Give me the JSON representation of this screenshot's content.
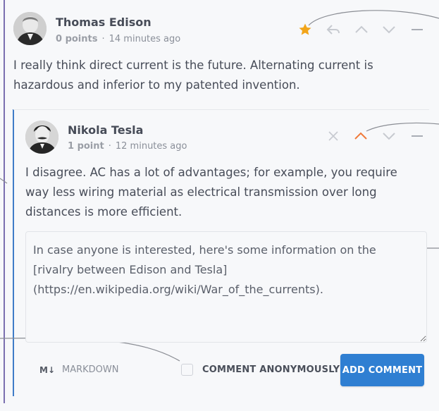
{
  "comments": [
    {
      "author": "Thomas Edison",
      "points": "0 points",
      "separator": "·",
      "time": "14 minutes ago",
      "text": "I really think direct current is the future. Alternating current is hazardous and inferior to my patented invention.",
      "avatar_icon": "edison-portrait"
    },
    {
      "author": "Nikola Tesla",
      "points": "1 point",
      "separator": "·",
      "time": "12 minutes ago",
      "text": "I disagree. AC has a lot of advantages; for example, you require way less wiring material as electrical transmission over long distances is more efficient.",
      "avatar_icon": "tesla-portrait"
    }
  ],
  "reply_box": {
    "value": "In case anyone is interested, here's some information on the [rivalry between Edison and Tesla](https://en.wikipedia.org/wiki/War_of_the_currents)."
  },
  "footer": {
    "markdown_symbol": "M↓",
    "markdown_label": "MARKDOWN",
    "anonymous_label": "COMMENT ANONYMOUSLY",
    "submit_label": "ADD COMMENT"
  },
  "colors": {
    "star": "#f2a51a",
    "upvote_active": "#f07a3a",
    "primary": "#2f7fd2",
    "outer_rail": "#7b6fb0",
    "inner_rail": "#3f7cc8"
  }
}
